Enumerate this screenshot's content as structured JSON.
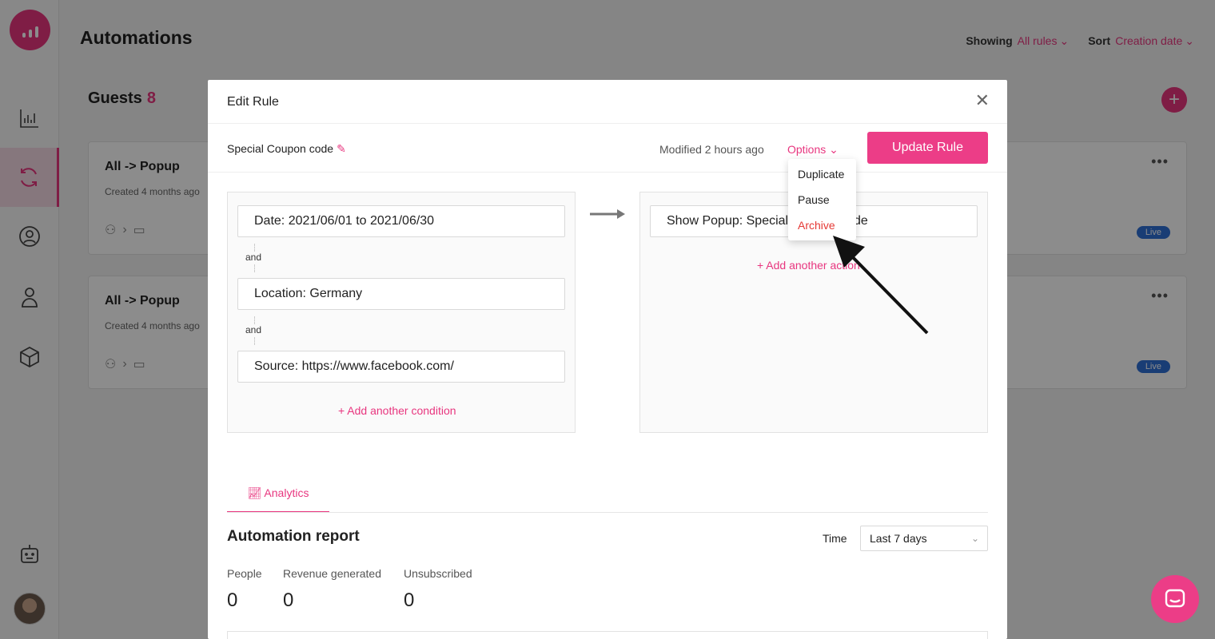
{
  "app": {
    "title": "Automations"
  },
  "filters": {
    "showing_label": "Showing",
    "showing_value": "All rules",
    "sort_label": "Sort",
    "sort_value": "Creation date"
  },
  "section": {
    "title": "Guests",
    "count": "8"
  },
  "rules": [
    {
      "title": "All -> Popup",
      "created": "Created 4 months ago",
      "status": "Live"
    },
    {
      "title": "All -> Popup",
      "created": "Created 4 months ago",
      "status": "Live"
    }
  ],
  "modal": {
    "title": "Edit Rule",
    "rule_name": "Special Coupon code",
    "modified": "Modified 2 hours ago",
    "options_label": "Options",
    "update_label": "Update Rule",
    "conditions": [
      "Date: 2021/06/01 to 2021/06/30",
      "Location: Germany",
      "Source: https://www.facebook.com/"
    ],
    "and_label": "and",
    "add_condition": "Add another condition",
    "actions": [
      "Show Popup: Special Coupon code"
    ],
    "add_action": "Add another action",
    "options_menu": [
      "Duplicate",
      "Pause",
      "Archive"
    ]
  },
  "analytics": {
    "tab_label": "Analytics",
    "report_title": "Automation report",
    "time_label": "Time",
    "time_value": "Last 7 days",
    "metrics": [
      {
        "label": "People",
        "value": "0"
      },
      {
        "label": "Revenue generated",
        "value": "0"
      },
      {
        "label": "Unsubscribed",
        "value": "0"
      }
    ]
  },
  "colors": {
    "accent": "#e8367f",
    "danger": "#e53935",
    "live": "#2f6fd6"
  }
}
